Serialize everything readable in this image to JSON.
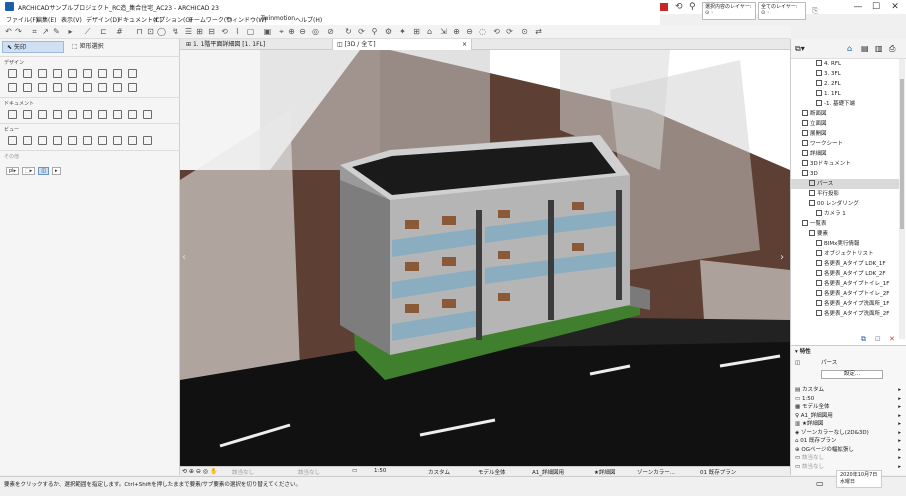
{
  "window": {
    "title": "ARCHICADサンプルプロジェクト_RC造_集合住宅_AC23 - ARCHICAD 23",
    "controls": [
      "—",
      "☐",
      "✕"
    ]
  },
  "menu": [
    "ファイル(F)",
    "編集(E)",
    "表示(V)",
    "デザイン(D)",
    "ドキュメント(C)",
    "オプション(O)",
    "チームワーク(T)",
    "ウィンドウ(W)",
    "Twinmotion",
    "ヘルプ(H)"
  ],
  "top_right": {
    "layer_combo_label": "選択内容のレイヤー:",
    "layer_combo_value": "全てのレイヤー:"
  },
  "toolbox": {
    "tabs": {
      "select": "矢印",
      "marquee": "矩形選択"
    },
    "sections": {
      "design": "デザイン",
      "document": "ドキュメント",
      "view": "ビュー",
      "other": "その他"
    },
    "mini_buttons": [
      "pl▸",
      "⬚▸",
      "◫",
      "▸"
    ]
  },
  "view_tabs": {
    "floor_plan": "1. 1階平面詳細図 [1. 1FL]",
    "view_3d": "[3D / 全て]",
    "close": "×"
  },
  "navigator": {
    "items": [
      {
        "label": "4. RFL",
        "indent": 3
      },
      {
        "label": "3. 3FL",
        "indent": 3
      },
      {
        "label": "2. 2FL",
        "indent": 3
      },
      {
        "label": "1. 1FL",
        "indent": 3
      },
      {
        "label": "-1. 基礎下端",
        "indent": 3
      },
      {
        "label": "断面図",
        "indent": 1
      },
      {
        "label": "立面図",
        "indent": 1
      },
      {
        "label": "展開図",
        "indent": 1
      },
      {
        "label": "ワークシート",
        "indent": 1
      },
      {
        "label": "詳細図",
        "indent": 1
      },
      {
        "label": "3Dドキュメント",
        "indent": 1
      },
      {
        "label": "3D",
        "indent": 1
      },
      {
        "label": "パース",
        "indent": 2,
        "selected": true
      },
      {
        "label": "平行投影",
        "indent": 2
      },
      {
        "label": "00 レンダリング",
        "indent": 2
      },
      {
        "label": "カメラ 1",
        "indent": 3
      },
      {
        "label": "一覧表",
        "indent": 1
      },
      {
        "label": "要素",
        "indent": 2
      },
      {
        "label": "BIMx実行情報",
        "indent": 3
      },
      {
        "label": "オブジェクトリスト",
        "indent": 3
      },
      {
        "label": "各更表_Aタイプ LDK_1F",
        "indent": 3
      },
      {
        "label": "各更表_Aタイプ LDK_2F",
        "indent": 3
      },
      {
        "label": "各更表_Aタイプトイレ_1F",
        "indent": 3
      },
      {
        "label": "各更表_Aタイプトイレ_2F",
        "indent": 3
      },
      {
        "label": "各更表_Aタイプ洗面所_1F",
        "indent": 3
      },
      {
        "label": "各更表_Aタイプ洗面所_2F",
        "indent": 3
      }
    ]
  },
  "properties": {
    "header": "特性",
    "view_name": "パース",
    "settings_button": "設定...",
    "rows": [
      "カスタム",
      "1:50",
      "モデル全体",
      "A1_詳細図用",
      "★詳細図",
      "ゾーンカラーなし(2D&3D)",
      "01 既存プラン",
      "OGページの幅拡張し",
      "該当なし",
      "該当なし"
    ]
  },
  "bottom": {
    "items": [
      "該当なし",
      "該当なし",
      "1:50",
      "カスタム",
      "モデル全体",
      "A1_詳細図用",
      "★詳細図",
      "ゾーンカラー...",
      "01 既存プラン"
    ]
  },
  "status": {
    "hint": "要素をクリックするか、選択範囲を指定します。Ctrl+Shiftを押したままで要素/サブ要素の選択を切り替えてください。",
    "date": "2020年10月7日",
    "weekday": "水曜日"
  },
  "colors": {
    "ground": "#5d4033",
    "road": "#111111",
    "lawn": "#3f7f2e",
    "roof": "#1a1a1a",
    "accent": "#1b5fa8"
  }
}
